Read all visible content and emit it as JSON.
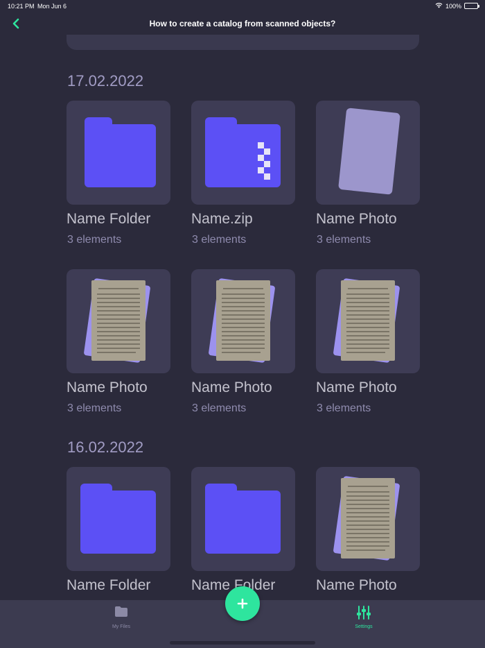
{
  "status_bar": {
    "time": "10:21 PM",
    "date": "Mon Jun 6",
    "battery": "100%"
  },
  "nav": {
    "title": "How to create a catalog from scanned objects?"
  },
  "sections": [
    {
      "date": "17.02.2022",
      "items": [
        {
          "name": "Name Folder",
          "count": "3 elements",
          "kind": "folder"
        },
        {
          "name": "Name.zip",
          "count": "3 elements",
          "kind": "zip"
        },
        {
          "name": "Name Photo",
          "count": "3 elements",
          "kind": "photo-blank"
        },
        {
          "name": "Name Photo",
          "count": "3 elements",
          "kind": "photo-doc"
        },
        {
          "name": "Name Photo",
          "count": "3 elements",
          "kind": "photo-doc"
        },
        {
          "name": "Name Photo",
          "count": "3 elements",
          "kind": "photo-doc"
        }
      ]
    },
    {
      "date": "16.02.2022",
      "items": [
        {
          "name": "Name Folder",
          "kind": "folder"
        },
        {
          "name": "Name Folder",
          "kind": "folder"
        },
        {
          "name": "Name Photo",
          "kind": "photo-doc"
        }
      ]
    }
  ],
  "tabs": [
    {
      "label": "My Files",
      "icon": "folder-icon"
    },
    {
      "label": "Settings",
      "icon": "sliders-icon"
    }
  ],
  "colors": {
    "background": "#2b2a3b",
    "tile": "#3e3c55",
    "accent_green": "#2ee59e",
    "folder_purple": "#5c50f5",
    "date_text": "#a19cc4",
    "tab_bar": "#3c3b50"
  }
}
